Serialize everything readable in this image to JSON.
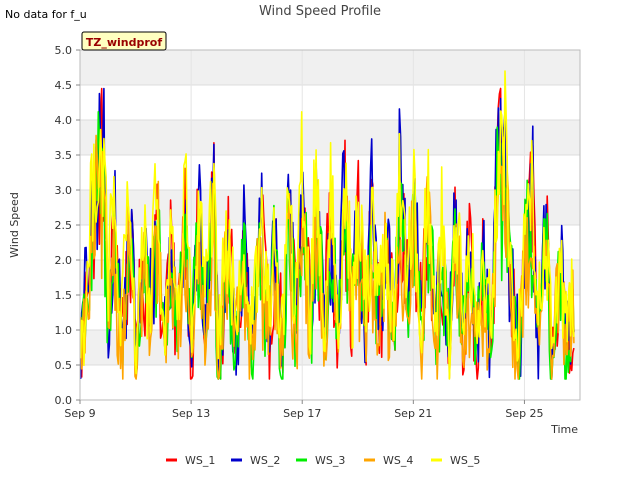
{
  "header": {
    "note": "No data for f_u",
    "title": "Wind Speed Profile"
  },
  "site_tag": "TZ_windprof",
  "chart_data": {
    "type": "line",
    "title": "Wind Speed Profile",
    "xlabel": "Time",
    "ylabel": "Wind Speed",
    "x_start": "Sep 9",
    "x_end": "Sep 27",
    "xlim_days": [
      9,
      27
    ],
    "ylim": [
      0.0,
      5.0
    ],
    "y_ticks": [
      "0.0",
      "0.5",
      "1.0",
      "1.5",
      "2.0",
      "2.5",
      "3.0",
      "3.5",
      "4.0",
      "4.5",
      "5.0"
    ],
    "x_ticks": [
      {
        "label": "Sep 9",
        "day": 9
      },
      {
        "label": "Sep 13",
        "day": 13
      },
      {
        "label": "Sep 17",
        "day": 17
      },
      {
        "label": "Sep 21",
        "day": 21
      },
      {
        "label": "Sep 25",
        "day": 25
      }
    ],
    "grid": true,
    "legend_position": "bottom",
    "series": [
      {
        "name": "WS_1",
        "color": "#ff0000"
      },
      {
        "name": "WS_2",
        "color": "#0000cc"
      },
      {
        "name": "WS_3",
        "color": "#00ee00"
      },
      {
        "name": "WS_4",
        "color": "#ffa500"
      },
      {
        "name": "WS_5",
        "color": "#ffff00"
      }
    ],
    "base_profile": {
      "days": [
        9.0,
        9.3,
        9.5,
        9.7,
        9.85,
        10.0,
        10.2,
        10.5,
        10.8,
        11.0,
        11.3,
        11.5,
        11.8,
        12.0,
        12.3,
        12.5,
        12.8,
        13.0,
        13.3,
        13.5,
        13.8,
        14.0,
        14.3,
        14.6,
        14.9,
        15.2,
        15.5,
        15.8,
        16.0,
        16.3,
        16.5,
        16.8,
        17.0,
        17.3,
        17.5,
        17.8,
        18.0,
        18.3,
        18.5,
        18.8,
        19.0,
        19.3,
        19.5,
        19.8,
        20.0,
        20.3,
        20.5,
        20.8,
        21.0,
        21.3,
        21.5,
        21.8,
        22.0,
        22.3,
        22.5,
        22.8,
        23.0,
        23.3,
        23.5,
        23.8,
        24.0,
        24.3,
        24.5,
        24.8,
        25.0,
        25.3,
        25.5,
        25.8,
        26.0,
        26.3,
        26.5,
        26.8
      ],
      "values": [
        0.6,
        1.8,
        2.8,
        3.2,
        3.4,
        1.2,
        2.5,
        1.0,
        2.4,
        0.8,
        2.0,
        1.2,
        2.6,
        0.8,
        2.2,
        1.0,
        2.8,
        0.7,
        2.5,
        1.0,
        2.8,
        0.6,
        2.2,
        0.9,
        2.0,
        0.7,
        2.4,
        1.0,
        2.0,
        0.8,
        2.6,
        1.1,
        3.0,
        1.2,
        2.8,
        1.0,
        2.5,
        0.9,
        3.0,
        1.2,
        2.5,
        1.0,
        2.6,
        1.2,
        2.2,
        1.0,
        3.0,
        1.4,
        2.6,
        0.9,
        2.8,
        1.0,
        2.2,
        0.8,
        2.4,
        1.0,
        2.0,
        0.7,
        1.8,
        0.9,
        3.0,
        3.4,
        1.5,
        0.8,
        2.0,
        2.8,
        1.0,
        2.2,
        0.7,
        1.8,
        1.0,
        1.3
      ]
    }
  }
}
